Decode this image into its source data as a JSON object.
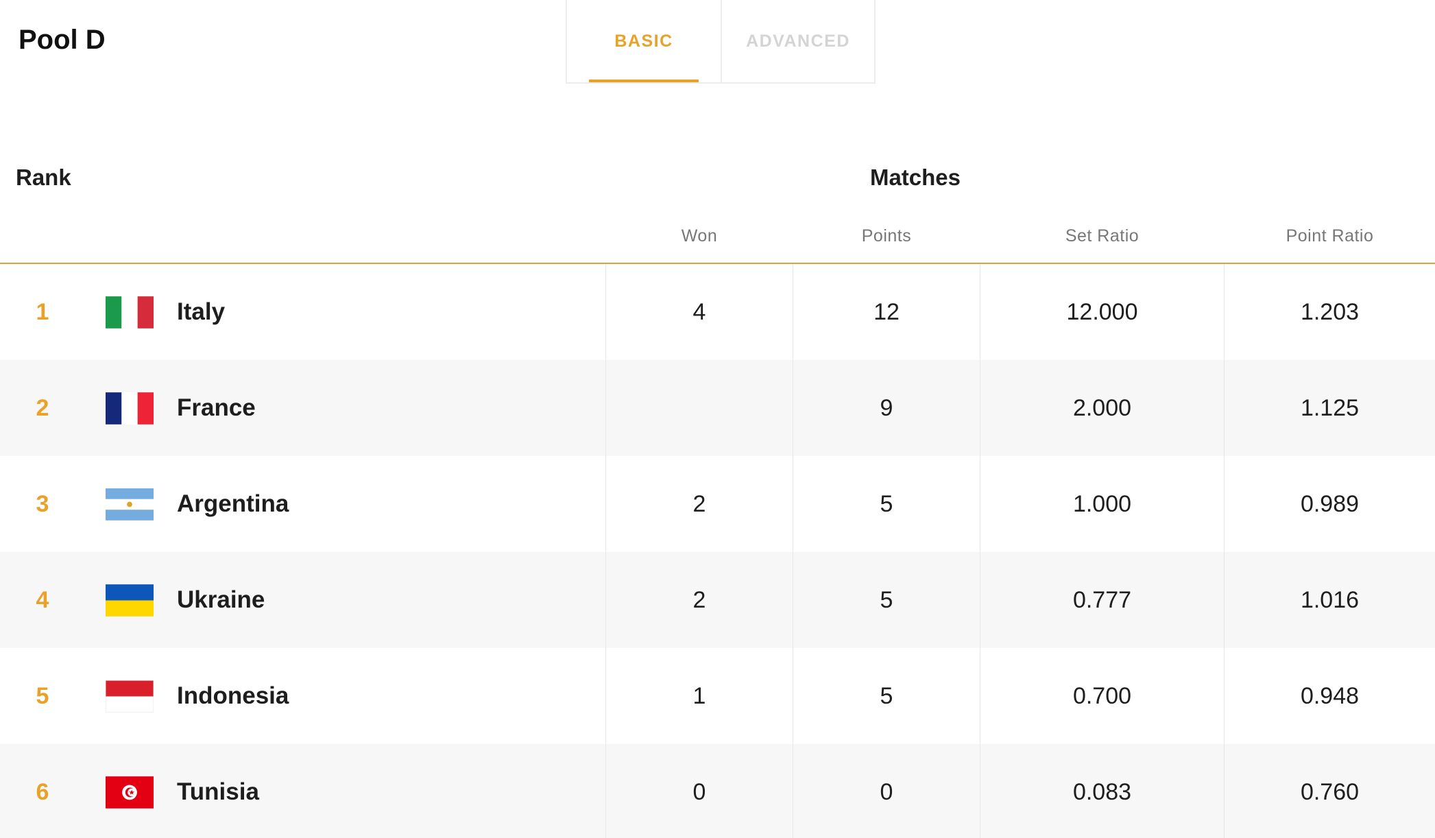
{
  "pool": {
    "title": "Pool D"
  },
  "tabs": [
    {
      "label": "BASIC",
      "active": true
    },
    {
      "label": "ADVANCED",
      "active": false
    }
  ],
  "table": {
    "rank_header": "Rank",
    "group_header": "Matches",
    "columns": {
      "won": "Won",
      "points": "Points",
      "set_ratio": "Set Ratio",
      "point_ratio": "Point Ratio"
    },
    "rows": [
      {
        "rank": "1",
        "team": "Italy",
        "flag": "italy-flag-icon",
        "won": "4",
        "points": "12",
        "set_ratio": "12.000",
        "point_ratio": "1.203"
      },
      {
        "rank": "2",
        "team": "France",
        "flag": "france-flag-icon",
        "won": "",
        "points": "9",
        "set_ratio": "2.000",
        "point_ratio": "1.125"
      },
      {
        "rank": "3",
        "team": "Argentina",
        "flag": "argentina-flag-icon",
        "won": "2",
        "points": "5",
        "set_ratio": "1.000",
        "point_ratio": "0.989"
      },
      {
        "rank": "4",
        "team": "Ukraine",
        "flag": "ukraine-flag-icon",
        "won": "2",
        "points": "5",
        "set_ratio": "0.777",
        "point_ratio": "1.016"
      },
      {
        "rank": "5",
        "team": "Indonesia",
        "flag": "indonesia-flag-icon",
        "won": "1",
        "points": "5",
        "set_ratio": "0.700",
        "point_ratio": "0.948"
      },
      {
        "rank": "6",
        "team": "Tunisia",
        "flag": "tunisia-flag-icon",
        "won": "0",
        "points": "0",
        "set_ratio": "0.083",
        "point_ratio": "0.760"
      }
    ]
  },
  "colors": {
    "accent": "#e8a22a",
    "header_line": "#d9a53a",
    "inactive_tab": "#d4d4d4",
    "row_alt": "#f7f7f7"
  }
}
